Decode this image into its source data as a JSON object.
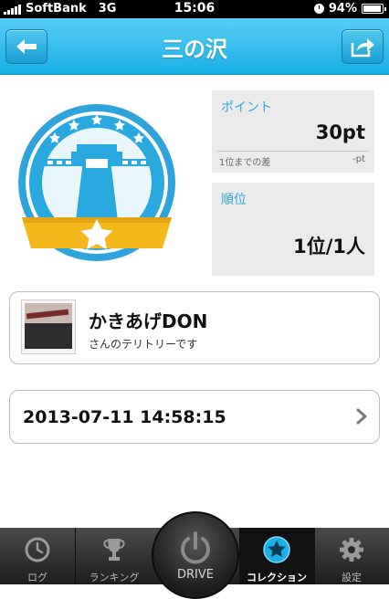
{
  "status_bar": {
    "carrier": "SoftBank",
    "network": "3G",
    "time": "15:06",
    "battery": "94%",
    "battery_level": 0.94
  },
  "nav": {
    "title": "三の沢",
    "back_icon": "back-arrow-icon",
    "share_icon": "share-icon"
  },
  "badge": {
    "icon": "dam-collection-badge"
  },
  "points_panel": {
    "title": "ポイント",
    "value": "30pt",
    "diff_label": "1位までの差",
    "diff_value": "-pt"
  },
  "rank_panel": {
    "title": "順位",
    "value": "1位/1人"
  },
  "owner_card": {
    "name": "かきあげDON",
    "subtitle": "さんのテリトリーです"
  },
  "date_row": {
    "datetime": "2013-07-11 14:58:15"
  },
  "tab_bar": {
    "tabs": [
      {
        "label": "ログ",
        "icon": "clock-icon"
      },
      {
        "label": "ランキング",
        "icon": "trophy-icon"
      },
      {
        "label": "DRIVE",
        "icon": "power-icon"
      },
      {
        "label": "コレクション",
        "icon": "star-icon"
      },
      {
        "label": "設定",
        "icon": "gear-icon"
      }
    ],
    "active": "コレクション"
  },
  "colors": {
    "accent": "#1ab0e6",
    "badge_blue": "#2aa9e0",
    "ribbon": "#f5b81c"
  }
}
